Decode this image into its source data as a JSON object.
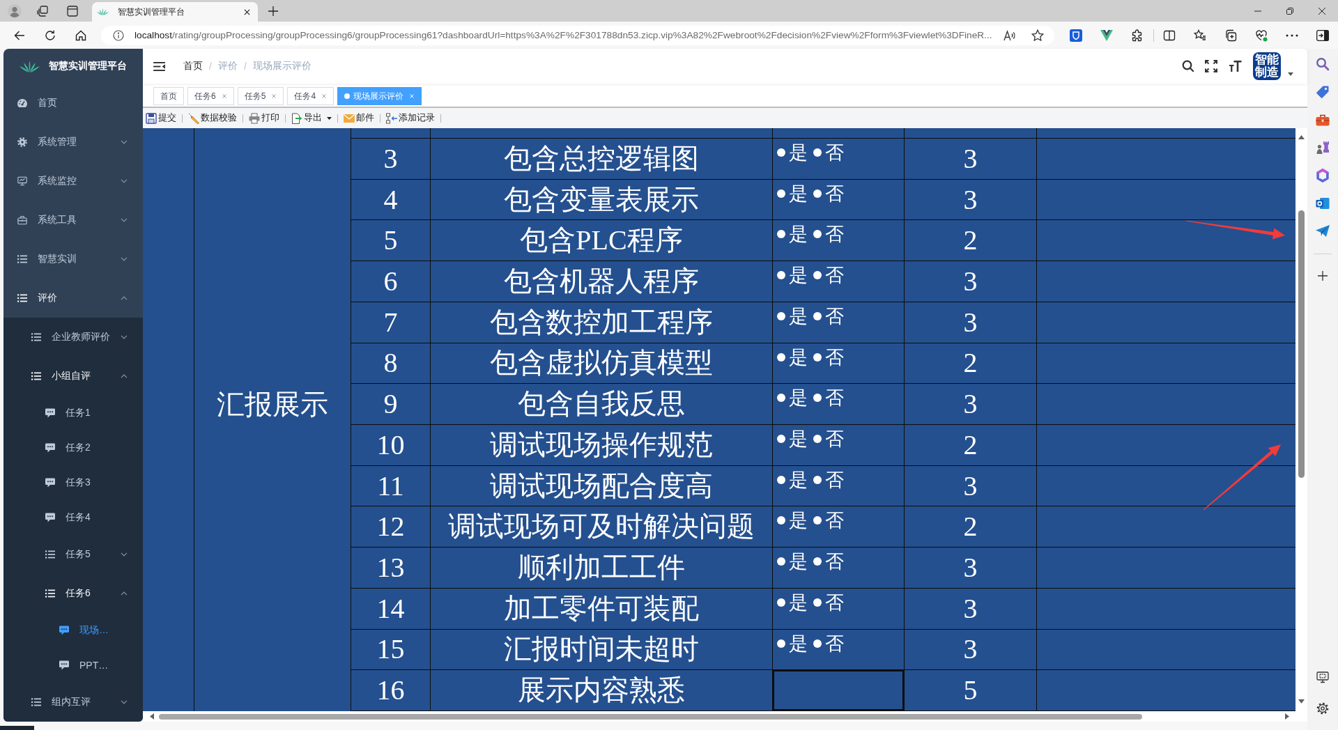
{
  "browser": {
    "tab": {
      "title": "智慧实训管理平台",
      "selected": true
    },
    "address": {
      "host": "localhost",
      "path": "/rating/groupProcessing/groupProcessing6/groupProcessing61?dashboardUrl=https%3A%2F%2F301788dn53.zicp.vip%3A82%2Fwebroot%2Fdecision%2Fview%2Fform%3Fviewlet%3DFineR..."
    }
  },
  "sidebar": {
    "title": "智慧实训管理平台",
    "items": [
      {
        "label": "首页",
        "kind": "dashboard",
        "selected": false
      },
      {
        "label": "系统管理",
        "kind": "settings",
        "selected": false,
        "expanded": false
      },
      {
        "label": "系统监控",
        "kind": "monitor",
        "selected": false,
        "expanded": false
      },
      {
        "label": "系统工具",
        "kind": "tools",
        "selected": false,
        "expanded": false
      },
      {
        "label": "智慧实训",
        "kind": "group",
        "selected": false,
        "expanded": false
      },
      {
        "label": "评价",
        "kind": "group",
        "selected": false,
        "expanded": true,
        "children": [
          {
            "label": "企业教师评价",
            "kind": "group",
            "selected": false,
            "expanded": false
          },
          {
            "label": "小组自评",
            "kind": "group",
            "selected": false,
            "expanded": true,
            "children": [
              {
                "label": "任务1",
                "kind": "page",
                "selected": false
              },
              {
                "label": "任务2",
                "kind": "page",
                "selected": false
              },
              {
                "label": "任务3",
                "kind": "page",
                "selected": false
              },
              {
                "label": "任务4",
                "kind": "page",
                "selected": false
              },
              {
                "label": "任务5",
                "kind": "group",
                "selected": false,
                "expanded": false
              },
              {
                "label": "任务6",
                "kind": "group",
                "selected": false,
                "expanded": true,
                "children": [
                  {
                    "label": "现场…",
                    "kind": "page",
                    "selected": true
                  },
                  {
                    "label": "PPT…",
                    "kind": "page",
                    "selected": false
                  }
                ]
              }
            ]
          },
          {
            "label": "组内互评",
            "kind": "group",
            "selected": false,
            "expanded": false
          }
        ]
      }
    ]
  },
  "header": {
    "breadcrumb": [
      {
        "label": "首页",
        "link": true
      },
      {
        "separator": "/",
        "label": "评价",
        "link": false
      },
      {
        "separator": "/",
        "label": "现场展示评价",
        "link": false
      }
    ],
    "avatar": "智能制造"
  },
  "tags": [
    {
      "label": "首页",
      "selected": false,
      "closable": false
    },
    {
      "label": "任务6",
      "selected": false,
      "closable": true
    },
    {
      "label": "任务5",
      "selected": false,
      "closable": true
    },
    {
      "label": "任务4",
      "selected": false,
      "closable": true
    },
    {
      "label": "现场展示评价",
      "selected": true,
      "closable": true
    }
  ],
  "toolbar": [
    {
      "label": "提交",
      "kind": "submit",
      "dropdown": false
    },
    {
      "label": "数据校验",
      "kind": "validate",
      "dropdown": false
    },
    {
      "label": "打印",
      "kind": "print",
      "dropdown": false
    },
    {
      "label": "导出",
      "kind": "export",
      "dropdown": true
    },
    {
      "label": "邮件",
      "kind": "mail",
      "dropdown": false
    },
    {
      "label": "添加记录",
      "kind": "add",
      "dropdown": false
    }
  ],
  "table": {
    "group": "汇报展示",
    "rows": [
      {
        "no": "3",
        "item": "包含总控逻辑图",
        "options": [
          {
            "label": "是",
            "selected": false
          },
          {
            "label": "否",
            "selected": false
          }
        ],
        "score": "3",
        "focused": false
      },
      {
        "no": "4",
        "item": "包含变量表展示",
        "options": [
          {
            "label": "是",
            "selected": false
          },
          {
            "label": "否",
            "selected": false
          }
        ],
        "score": "3",
        "focused": false
      },
      {
        "no": "5",
        "item": "包含PLC程序",
        "options": [
          {
            "label": "是",
            "selected": false
          },
          {
            "label": "否",
            "selected": false
          }
        ],
        "score": "2",
        "focused": false
      },
      {
        "no": "6",
        "item": "包含机器人程序",
        "options": [
          {
            "label": "是",
            "selected": false
          },
          {
            "label": "否",
            "selected": false
          }
        ],
        "score": "3",
        "focused": false
      },
      {
        "no": "7",
        "item": "包含数控加工程序",
        "options": [
          {
            "label": "是",
            "selected": false
          },
          {
            "label": "否",
            "selected": false
          }
        ],
        "score": "3",
        "focused": false
      },
      {
        "no": "8",
        "item": "包含虚拟仿真模型",
        "options": [
          {
            "label": "是",
            "selected": false
          },
          {
            "label": "否",
            "selected": false
          }
        ],
        "score": "2",
        "focused": false
      },
      {
        "no": "9",
        "item": "包含自我反思",
        "options": [
          {
            "label": "是",
            "selected": false
          },
          {
            "label": "否",
            "selected": false
          }
        ],
        "score": "3",
        "focused": false
      },
      {
        "no": "10",
        "item": "调试现场操作规范",
        "options": [
          {
            "label": "是",
            "selected": false
          },
          {
            "label": "否",
            "selected": false
          }
        ],
        "score": "2",
        "focused": false
      },
      {
        "no": "11",
        "item": "调试现场配合度高",
        "options": [
          {
            "label": "是",
            "selected": false
          },
          {
            "label": "否",
            "selected": false
          }
        ],
        "score": "3",
        "focused": false
      },
      {
        "no": "12",
        "item": "调试现场可及时解决问题",
        "options": [
          {
            "label": "是",
            "selected": false
          },
          {
            "label": "否",
            "selected": false
          }
        ],
        "score": "2",
        "focused": false
      },
      {
        "no": "13",
        "item": "顺利加工工件",
        "options": [
          {
            "label": "是",
            "selected": false
          },
          {
            "label": "否",
            "selected": false
          }
        ],
        "score": "3",
        "focused": false
      },
      {
        "no": "14",
        "item": "加工零件可装配",
        "options": [
          {
            "label": "是",
            "selected": false
          },
          {
            "label": "否",
            "selected": false
          }
        ],
        "score": "3",
        "focused": false
      },
      {
        "no": "15",
        "item": "汇报时间未超时",
        "options": [
          {
            "label": "是",
            "selected": false
          },
          {
            "label": "否",
            "selected": false
          }
        ],
        "score": "3",
        "focused": false
      },
      {
        "no": "16",
        "item": "展示内容熟悉",
        "score": "5",
        "focused": true
      }
    ]
  }
}
